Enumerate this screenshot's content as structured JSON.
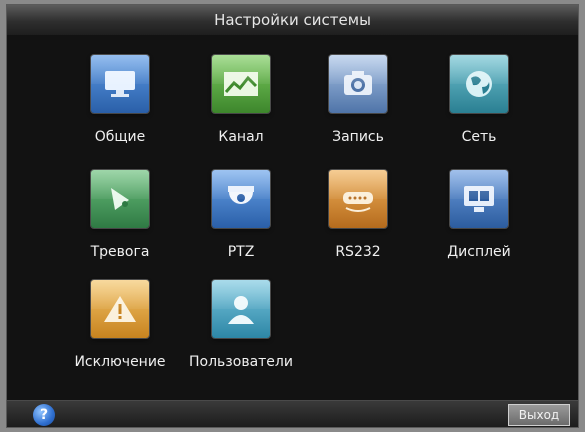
{
  "window": {
    "title": "Настройки системы"
  },
  "icons": [
    {
      "label": "Общие",
      "icon": "monitor-icon",
      "color": "#3b78c4"
    },
    {
      "label": "Канал",
      "icon": "landscape-icon",
      "color": "#4f9b3a"
    },
    {
      "label": "Запись",
      "icon": "camera-icon",
      "color": "#5a7fb0"
    },
    {
      "label": "Сеть",
      "icon": "globe-icon",
      "color": "#3a8fa0"
    },
    {
      "label": "Тревога",
      "icon": "alarm-bell-icon",
      "color": "#3f8a54"
    },
    {
      "label": "PTZ",
      "icon": "dome-camera-icon",
      "color": "#3b74c0"
    },
    {
      "label": "RS232",
      "icon": "serial-port-icon",
      "color": "#c87f2a"
    },
    {
      "label": "Дисплей",
      "icon": "display-icon",
      "color": "#3a6cb4"
    },
    {
      "label": "Исключение",
      "icon": "warning-icon",
      "color": "#d59a2c"
    },
    {
      "label": "Пользователи",
      "icon": "user-icon",
      "color": "#3c9ab8"
    }
  ],
  "statusbar": {
    "help_label": "?",
    "exit_label": "Выход"
  }
}
